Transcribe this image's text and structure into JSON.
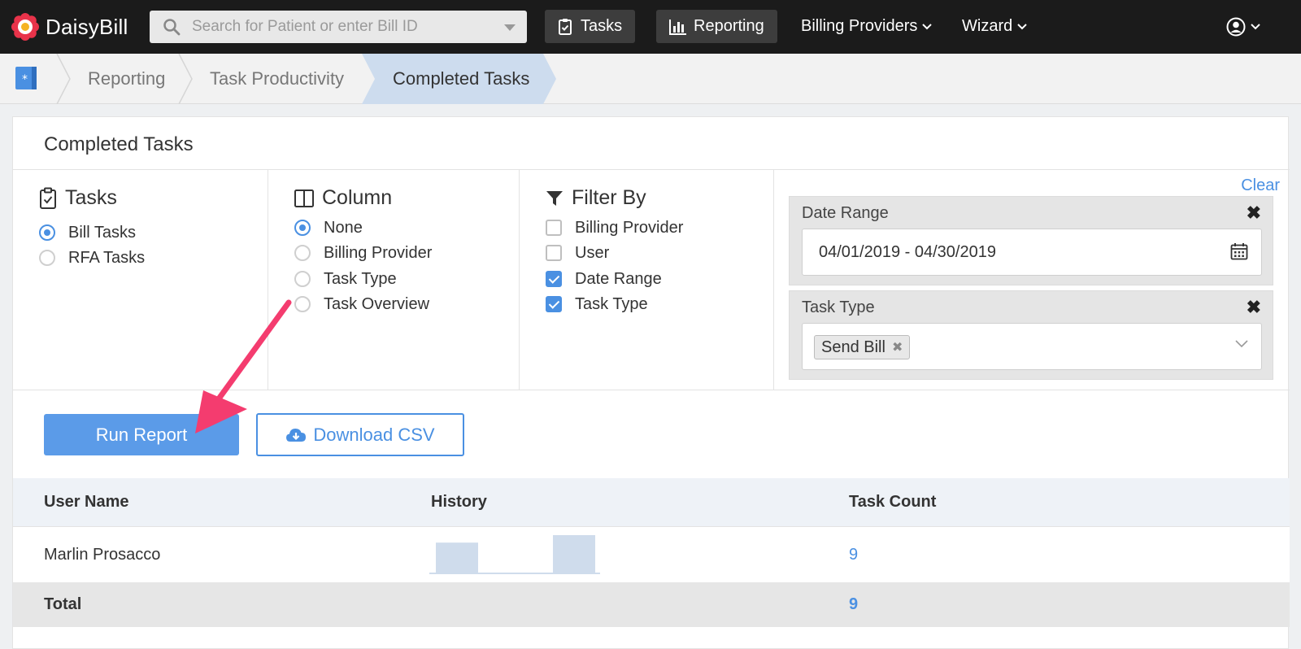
{
  "app": {
    "logo_text": "DaisyBill",
    "search_placeholder": "Search for Patient or enter Bill ID"
  },
  "nav": {
    "tasks": "Tasks",
    "reporting": "Reporting",
    "billing_providers": "Billing Providers",
    "wizard": "Wizard"
  },
  "breadcrumb": {
    "items": [
      "Reporting",
      "Task Productivity"
    ],
    "active": "Completed Tasks"
  },
  "panel": {
    "title": "Completed Tasks",
    "tasks": {
      "heading": "Tasks",
      "options": [
        {
          "label": "Bill Tasks",
          "selected": true
        },
        {
          "label": "RFA Tasks",
          "selected": false
        }
      ]
    },
    "column": {
      "heading": "Column",
      "options": [
        {
          "label": "None",
          "selected": true
        },
        {
          "label": "Billing Provider",
          "selected": false
        },
        {
          "label": "Task Type",
          "selected": false
        },
        {
          "label": "Task Overview",
          "selected": false
        }
      ]
    },
    "filter_by": {
      "heading": "Filter By",
      "options": [
        {
          "label": "Billing Provider",
          "checked": false
        },
        {
          "label": "User",
          "checked": false
        },
        {
          "label": "Date Range",
          "checked": true
        },
        {
          "label": "Task Type",
          "checked": true
        }
      ]
    },
    "filters": {
      "clear_label": "Clear",
      "date_range": {
        "label": "Date Range",
        "value": "04/01/2019 - 04/30/2019"
      },
      "task_type": {
        "label": "Task Type",
        "tag": "Send Bill"
      }
    },
    "buttons": {
      "run_report": "Run Report",
      "download_csv": "Download CSV"
    },
    "table": {
      "headers": [
        "User Name",
        "History",
        "Task Count"
      ],
      "rows": [
        {
          "user_name": "Marlin Prosacco",
          "history": [
            4,
            0,
            5
          ],
          "task_count": "9"
        }
      ],
      "total_label": "Total",
      "total_count": "9"
    }
  },
  "colors": {
    "accent": "#4a90e2",
    "nav_bg": "#1b1b1b",
    "arrow": "#f43c6f",
    "sparkbar": "#cfdcec"
  }
}
